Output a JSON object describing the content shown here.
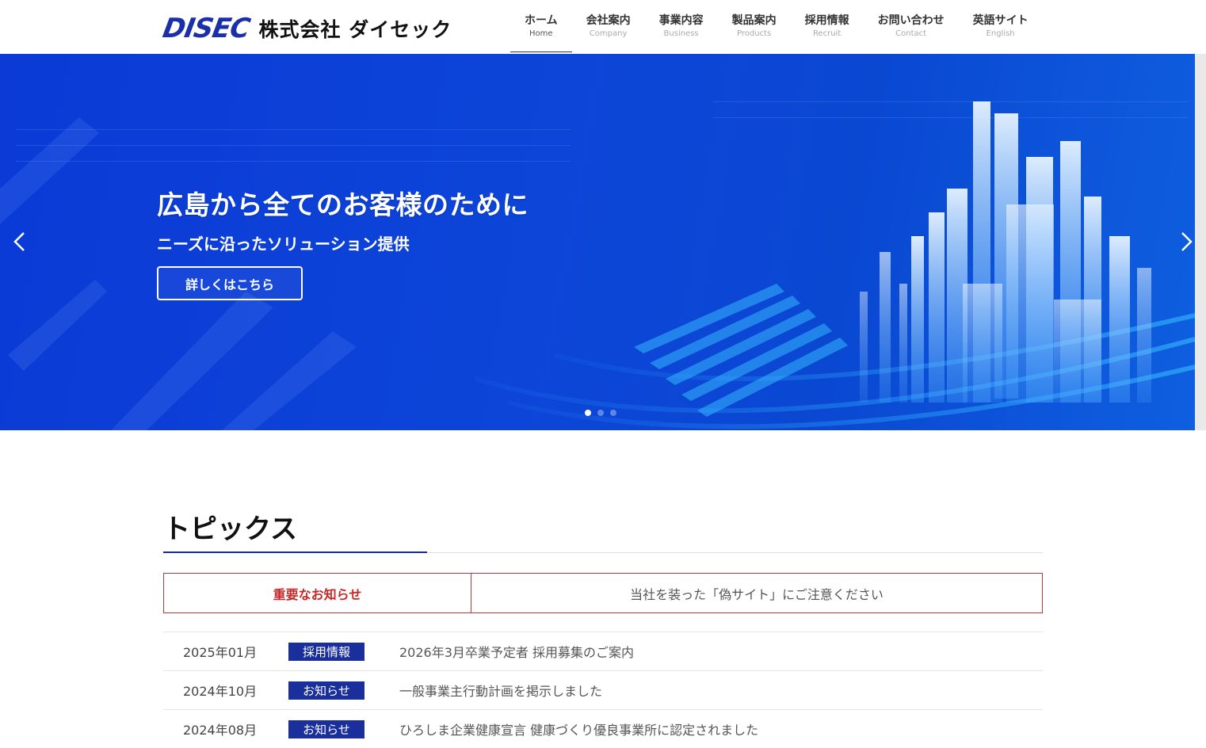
{
  "header": {
    "logo_mark": "DISEC",
    "company_name": "株式会社 ダイセック"
  },
  "nav": [
    {
      "jp": "ホーム",
      "en": "Home",
      "active": true
    },
    {
      "jp": "会社案内",
      "en": "Company"
    },
    {
      "jp": "事業内容",
      "en": "Business"
    },
    {
      "jp": "製品案内",
      "en": "Products"
    },
    {
      "jp": "採用情報",
      "en": "Recruit"
    },
    {
      "jp": "お問い合わせ",
      "en": "Contact"
    },
    {
      "jp": "英語サイト",
      "en": "English"
    }
  ],
  "hero": {
    "title": "広島から全てのお客様のために",
    "subtitle": "ニーズに沿ったソリューション提供",
    "button": "詳しくはこちら",
    "prev_icon": "chevron-left-icon",
    "next_icon": "chevron-right-icon",
    "slide_count": 3,
    "active_slide": 1
  },
  "topics": {
    "heading": "トピックス",
    "alert": {
      "label": "重要なお知らせ",
      "text": "当社を装った「偽サイト」にご注意ください"
    },
    "news": [
      {
        "date": "2025年01月",
        "tag": "採用情報",
        "text": "2026年3月卒業予定者 採用募集のご案内"
      },
      {
        "date": "2024年10月",
        "tag": "お知らせ",
        "text": "一般事業主行動計画を掲示しました"
      },
      {
        "date": "2024年08月",
        "tag": "お知らせ",
        "text": "ひろしま企業健康宣言 健康づくり優良事業所に認定されました"
      }
    ]
  },
  "colors": {
    "brand_blue": "#1a2fa8",
    "hero_blue": "#0b3ad6",
    "tag_blue": "#1a2f9c",
    "alert_red": "#c62828"
  }
}
